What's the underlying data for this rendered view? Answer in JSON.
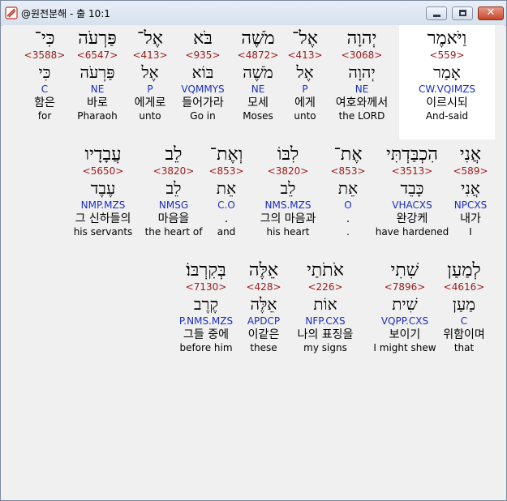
{
  "window": {
    "title": "@원전분해 - 출 10:1",
    "close_label": "✕"
  },
  "rows": [
    {
      "words": [
        {
          "heb": "כִּי־",
          "strong": "<3588>",
          "lemma": "כִּי",
          "parse": "C",
          "kor": "함은",
          "eng": "for"
        },
        {
          "heb": "פַּרְעֹה",
          "strong": "<6547>",
          "lemma": "פַּרְעֹה",
          "parse": "NE",
          "kor": "바로",
          "eng": "Pharaoh"
        },
        {
          "heb": "אֶל־",
          "strong": "<413>",
          "lemma": "אֶל",
          "parse": "P",
          "kor": "에게로",
          "eng": "unto"
        },
        {
          "heb": "בֹּא",
          "strong": "<935>",
          "lemma": "בּוֹא",
          "parse": "VQMMYS",
          "kor": "들어가라",
          "eng": "Go in"
        },
        {
          "heb": "מֹשֶׁה",
          "strong": "<4872>",
          "lemma": "מֹשֶׁה",
          "parse": "NE",
          "kor": "모세",
          "eng": "Moses"
        },
        {
          "heb": "אֶל־",
          "strong": "<413>",
          "lemma": "אֶל",
          "parse": "P",
          "kor": "에게",
          "eng": "unto"
        },
        {
          "heb": "יְהוָה",
          "strong": "<3068>",
          "lemma": "יְהוָה",
          "parse": "NE",
          "kor": "여호와께서",
          "eng": "the LORD"
        },
        {
          "heb": "וַיֹּאמֶר",
          "strong": "<559>",
          "lemma": "אָמַר",
          "parse": "CW.VQIMZS",
          "kor": "이르시되",
          "eng": "And-said"
        }
      ]
    },
    {
      "words": [
        {
          "heb": "עֲבָדָיו",
          "strong": "<5650>",
          "lemma": "עֶבֶד",
          "parse": "NMP.MZS",
          "kor": "그 신하들의",
          "eng": "his servants"
        },
        {
          "heb": "לֵב",
          "strong": "<3820>",
          "lemma": "לֵב",
          "parse": "NMSG",
          "kor": "마음을",
          "eng": "the heart of"
        },
        {
          "heb": "וְאֶת־",
          "strong": "<853>",
          "lemma": "אֵת",
          "parse": "C.O",
          "kor": ".",
          "eng": "and"
        },
        {
          "heb": "לִבּוֹ",
          "strong": "<3820>",
          "lemma": "לֵב",
          "parse": "NMS.MZS",
          "kor": "그의 마음과",
          "eng": "his heart"
        },
        {
          "heb": "אֶת־",
          "strong": "<853>",
          "lemma": "אֵת",
          "parse": "O",
          "kor": ".",
          "eng": "."
        },
        {
          "heb": "הִכְבַּדְתִּי",
          "strong": "<3513>",
          "lemma": "כָּבֵד",
          "parse": "VHACXS",
          "kor": "완강케",
          "eng": "have hardened"
        },
        {
          "heb": "אֲנִי",
          "strong": "<589>",
          "lemma": "אֲנִי",
          "parse": "NPCXS",
          "kor": "내가",
          "eng": "I"
        }
      ]
    },
    {
      "words": [
        {
          "heb": "בְּקִרְבּוֹ׃",
          "strong": "<7130>",
          "lemma": "קֶרֶב",
          "parse": "P.NMS.MZS",
          "kor": "그들 중에",
          "eng": "before him"
        },
        {
          "heb": "אֵלֶּה",
          "strong": "<428>",
          "lemma": "אֵלֶּה",
          "parse": "APDCP",
          "kor": "이같은",
          "eng": "these"
        },
        {
          "heb": "אֹתֹתַי",
          "strong": "<226>",
          "lemma": "אוֹת",
          "parse": "NFP.CXS",
          "kor": "나의 표징을",
          "eng": "my signs"
        },
        {
          "heb": "שִׁתִי",
          "strong": "<7896>",
          "lemma": "שִׁית",
          "parse": "VQPP.CXS",
          "kor": "보이기",
          "eng": "I might shew"
        },
        {
          "heb": "לְמַעַן",
          "strong": "<4616>",
          "lemma": "מַעַן",
          "parse": "C",
          "kor": "위함이며",
          "eng": "that"
        }
      ]
    }
  ]
}
